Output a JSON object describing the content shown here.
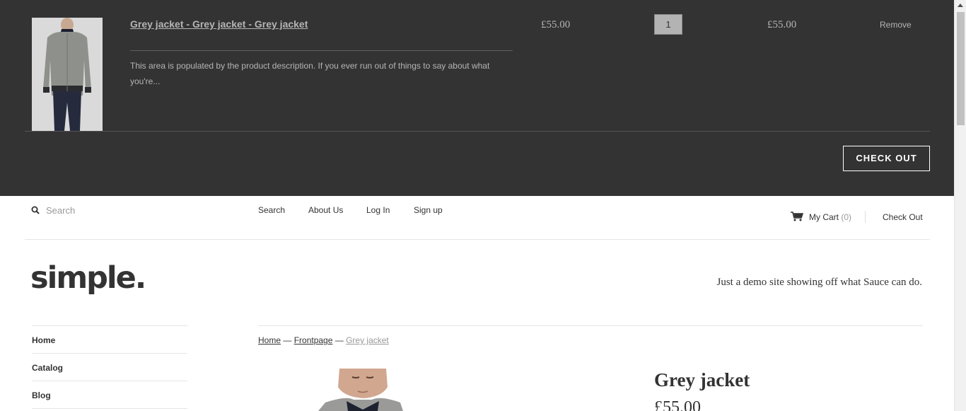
{
  "cart": {
    "item": {
      "title": "Grey jacket - Grey jacket - Grey jacket",
      "description": "This area is populated by the product description. If you ever run out of things to say about what you're...",
      "price": "£55.00",
      "quantity": "1",
      "line_total": "£55.00",
      "remove_label": "Remove"
    },
    "checkout_label": "CHECK OUT"
  },
  "topbar": {
    "search_placeholder": "Search",
    "nav": [
      "Search",
      "About Us",
      "Log In",
      "Sign up"
    ],
    "mycart_label": "My Cart",
    "mycart_count": "(0)",
    "checkout_label": "Check Out"
  },
  "header": {
    "logo": "simple.",
    "tagline": "Just a demo site showing off what Sauce can do."
  },
  "sidebar": {
    "items": [
      "Home",
      "Catalog",
      "Blog"
    ]
  },
  "breadcrumb": {
    "home": "Home",
    "sep1": " — ",
    "collection": "Frontpage",
    "sep2": " — ",
    "current": "Grey jacket"
  },
  "product": {
    "title": "Grey jacket",
    "price": "£55.00"
  },
  "colors": {
    "drawer_bg": "#333333",
    "drawer_text": "#b5b5b5",
    "page_bg": "#ffffff",
    "text": "#333333",
    "muted": "#999999"
  }
}
